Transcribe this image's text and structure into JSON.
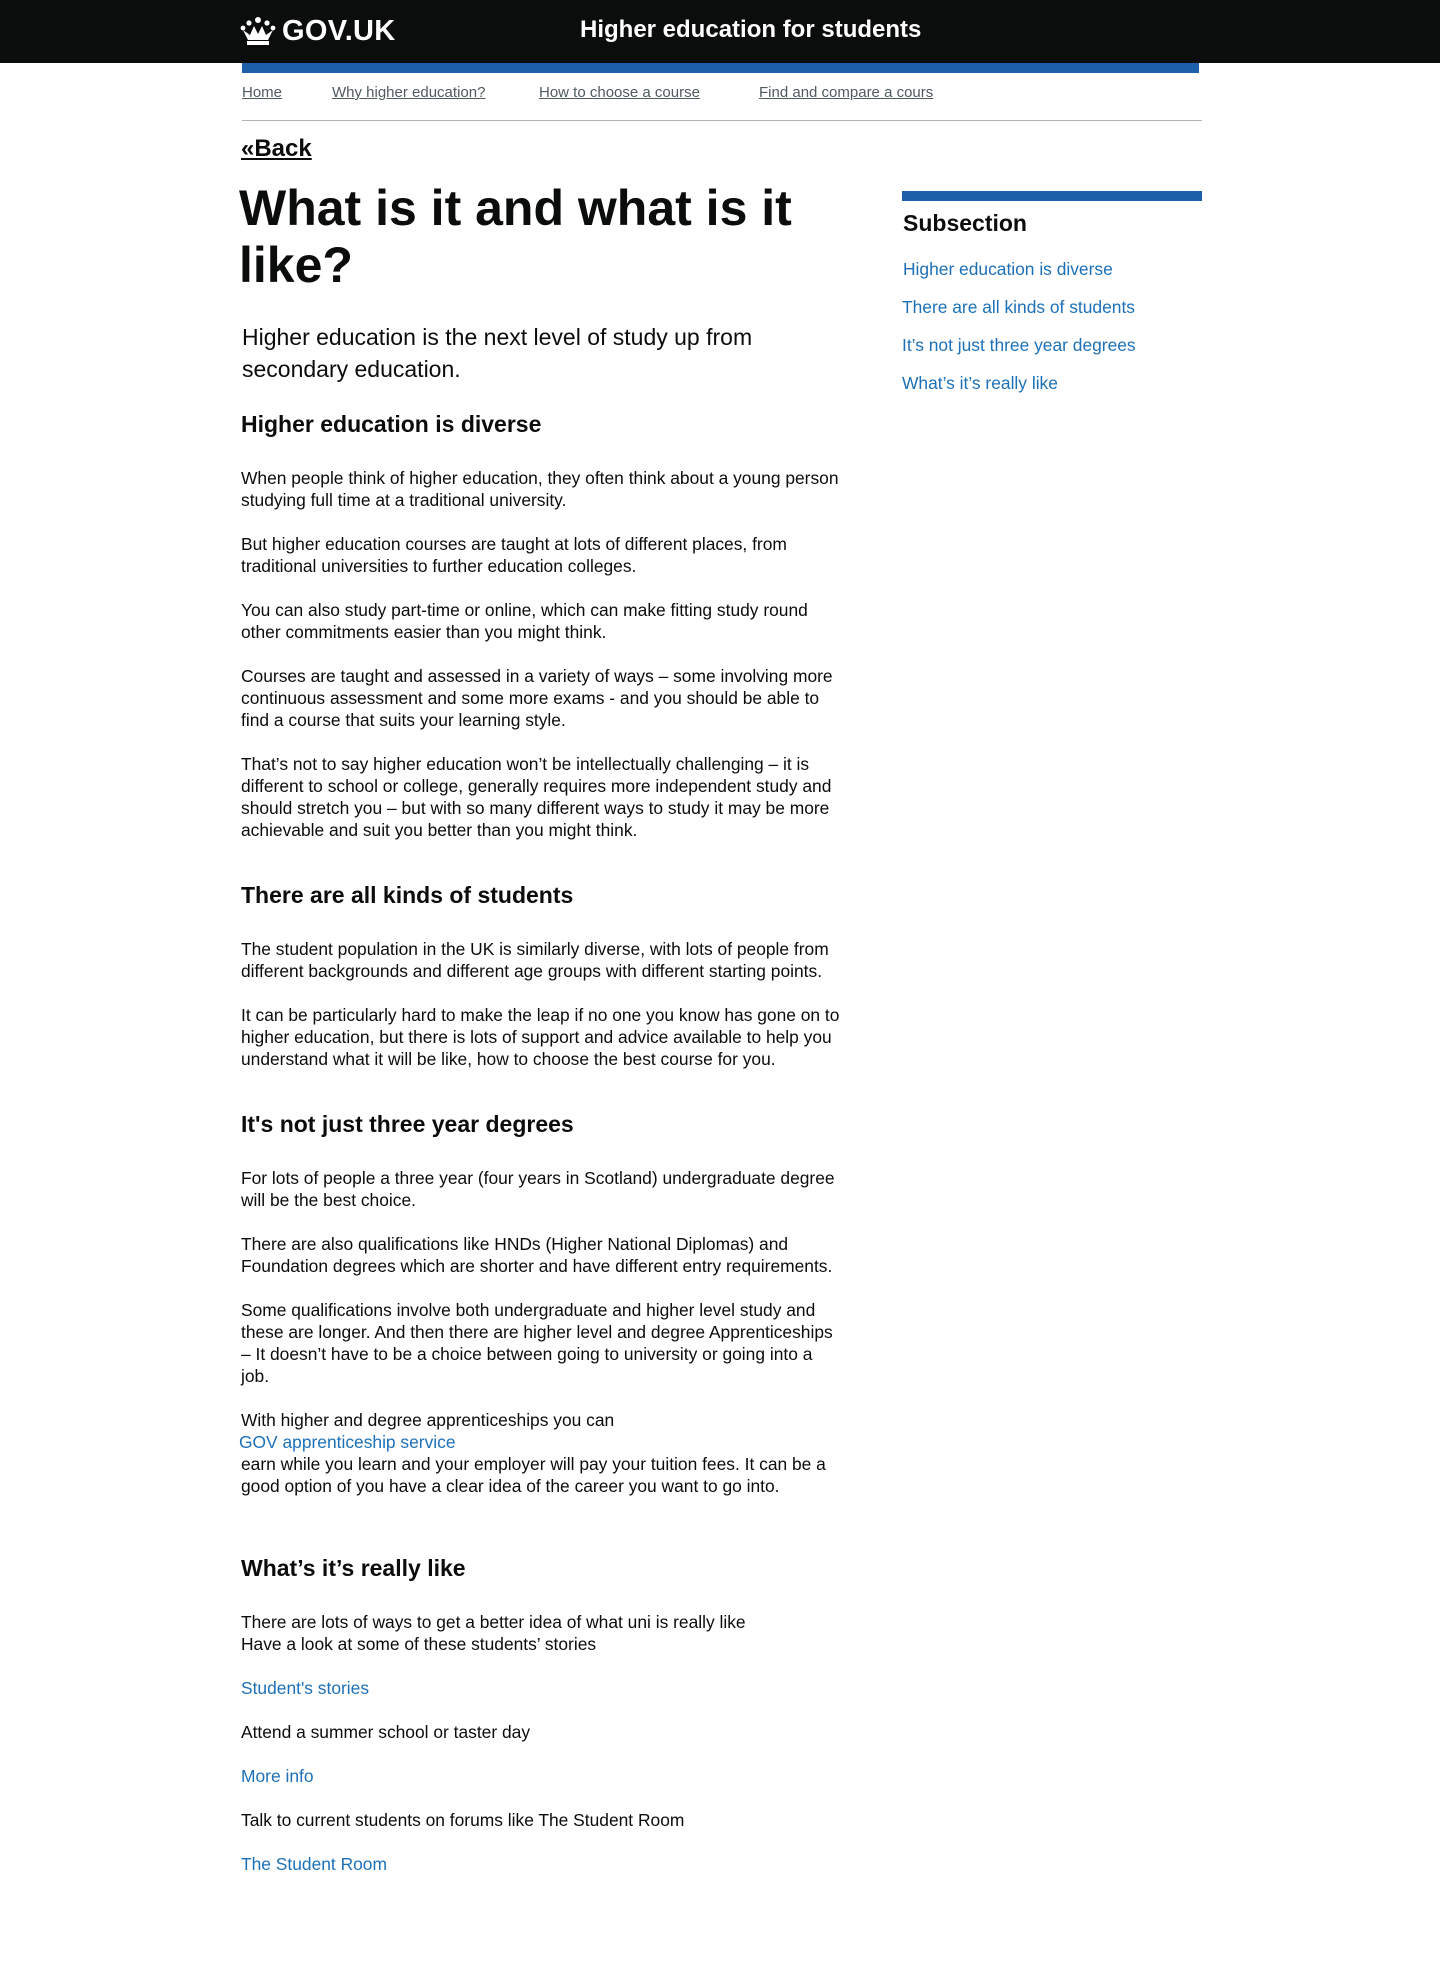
{
  "header": {
    "logo_text": "GOV.UK",
    "service_name": "Higher education for students",
    "crown_icon": "crown-icon"
  },
  "nav": {
    "items": [
      "Home",
      "Why higher education?",
      "How to choose a course",
      "Find and compare a cours"
    ]
  },
  "back_link": "«Back",
  "page": {
    "title": "What is it and what is it like?",
    "lead": "Higher education is the next level of study up from secondary education."
  },
  "sections": {
    "diverse": {
      "heading": "Higher education is diverse",
      "paragraphs": [
        "When people think of higher education, they often think about a young person studying full time at a traditional university.",
        "But higher education courses are taught at lots of different places, from traditional universities to further education colleges.",
        "You can also study part-time or online, which can make fitting study round other commitments easier than you might think.",
        "Courses are taught and assessed in a variety of ways – some involving more continuous assessment and some more exams - and you should be able to find a course that suits your learning style.",
        "That’s not to say higher education won’t be intellectually challenging – it is different to school or college, generally requires more independent study and should stretch you – but with so many different ways to study it may be more achievable and suit you better than you might think."
      ]
    },
    "students": {
      "heading": "There are all kinds of students",
      "paragraphs": [
        "The student population in the UK is similarly diverse, with lots of people from different backgrounds and different age groups with different starting points.",
        "It can be particularly hard to make the leap if no one you know has gone on to higher education, but there is lots of support and advice available to help you understand what it will be like, how to choose the best course for you."
      ]
    },
    "degrees": {
      "heading": "It's not just three year degrees",
      "paragraphs": [
        "For lots of people a three year (four years in Scotland) undergraduate degree will be the best choice.",
        "There are also qualifications like HNDs (Higher National Diplomas) and Foundation degrees which are shorter and have different entry requirements.",
        "Some qualifications involve both undergraduate and higher level study and these are longer. And then there are higher level and degree Apprenticeships – It doesn’t have to be a choice between going to university or going into a job."
      ],
      "apprentice_intro": "With higher and degree apprenticeships you can",
      "apprentice_link": "GOV apprenticeship service",
      "apprentice_rest": "earn while you learn and your employer will pay your tuition fees. It can be a good option of you have a clear idea of the career you want to go into."
    },
    "really_like": {
      "heading": "What’s it’s really like",
      "intro_line_1": "There are lots of ways to get a better idea of what uni is really like",
      "intro_line_2": "Have a look at some of these students’ stories",
      "link_stories": "Student's stories",
      "summer_text": "Attend a summer school or taster day",
      "link_more": "More info",
      "forums_text": "Talk to current students on forums like The Student Room",
      "link_tsr": "The Student Room"
    }
  },
  "sidebar": {
    "title": "Subsection",
    "links": [
      "Higher education is diverse",
      "There are all kinds of students",
      "It’s not just three year degrees",
      "What’s it’s really like"
    ]
  }
}
